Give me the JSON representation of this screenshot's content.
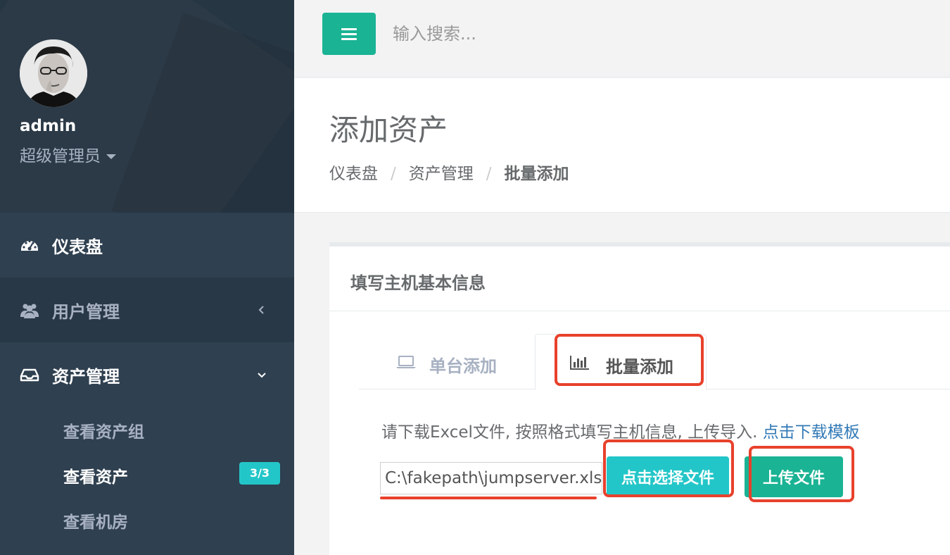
{
  "sidebar": {
    "username": "admin",
    "role": "超级管理员",
    "nav": {
      "dashboard": "仪表盘",
      "users": "用户管理",
      "assets": "资产管理"
    },
    "sub_items": [
      "查看资产组",
      "查看资产",
      "查看机房"
    ],
    "badge": "3/3"
  },
  "topbar": {
    "search_placeholder": "输入搜索..."
  },
  "heading": {
    "title": "添加资产",
    "breadcrumb": [
      "仪表盘",
      "资产管理",
      "批量添加"
    ]
  },
  "card": {
    "title": "填写主机基本信息",
    "tabs": {
      "single": "单台添加",
      "batch": "批量添加"
    },
    "instruction": "请下载Excel文件, 按照格式填写主机信息, 上传导入.",
    "download_link": "点击下载模板",
    "file_value": "C:\\fakepath\\jumpserver.xlsx",
    "choose_button": "点击选择文件",
    "upload_button": "上传文件"
  },
  "colors": {
    "sidebar_bg": "#2f4050",
    "primary": "#1ab394",
    "info": "#23c6c8",
    "annotation": "#e8412c",
    "link": "#337ab7"
  }
}
